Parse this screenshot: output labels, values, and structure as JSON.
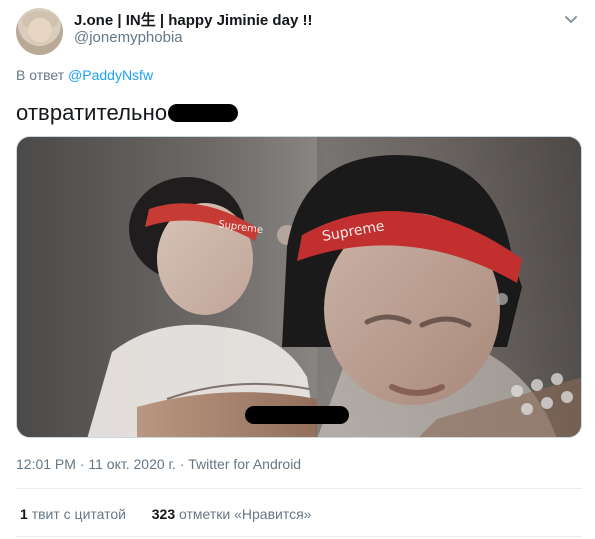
{
  "tweet": {
    "display_name": "J.one | IN生 | happy Jiminie day !!",
    "handle": "@jonemyphobia",
    "reply_prefix": "В ответ",
    "reply_to": "@PaddyNsfw",
    "text": "отвратительно",
    "timestamp": "12:01 PM · 11 окт. 2020 г. · Twitter for Android"
  },
  "stats": {
    "quote_count": "1",
    "quote_label": "твит с цитатой",
    "like_count": "323",
    "like_label": "отметки «Нравится»"
  },
  "icons": {
    "caret": "chevron-down-icon"
  },
  "colors": {
    "link": "#1da1f2",
    "muted": "#657786",
    "text": "#14171a"
  }
}
